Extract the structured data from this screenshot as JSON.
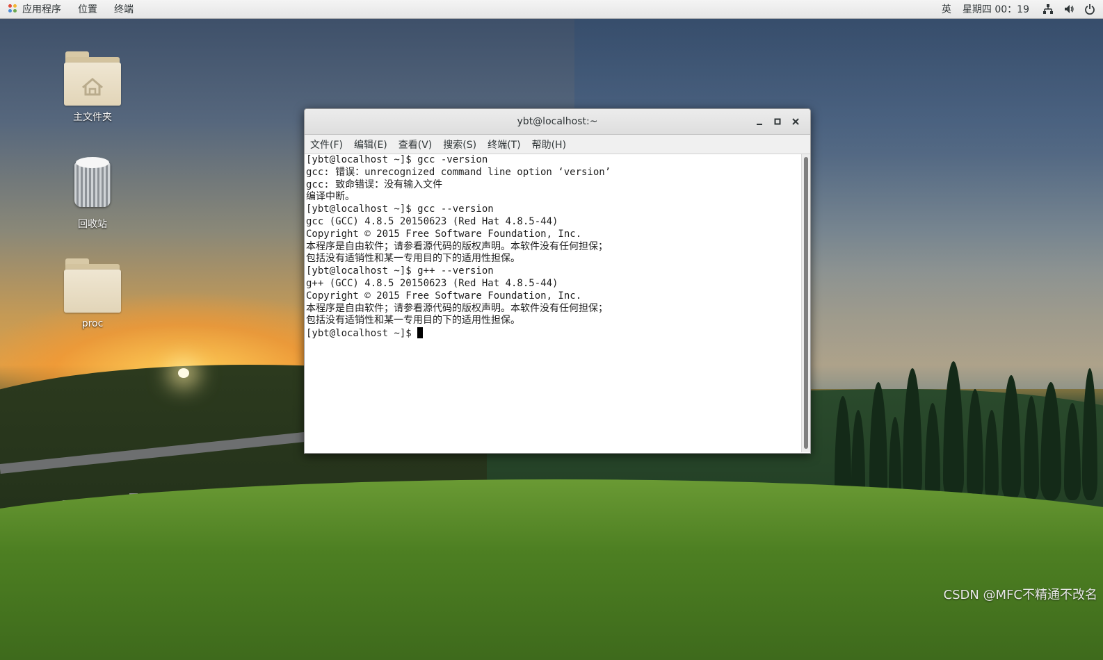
{
  "top_panel": {
    "applications": "应用程序",
    "places": "位置",
    "terminal": "终端",
    "input_method": "英",
    "clock": "星期四 00：19",
    "network_icon": "network-icon",
    "volume_icon": "volume-icon",
    "power_icon": "power-icon"
  },
  "desktop": {
    "icons": [
      {
        "label": "主文件夹",
        "icon": "home-folder-icon"
      },
      {
        "label": "回收站",
        "icon": "trash-icon"
      },
      {
        "label": "proc",
        "icon": "folder-icon"
      }
    ]
  },
  "terminal": {
    "title": "ybt@localhost:~",
    "menu": [
      "文件(F)",
      "编辑(E)",
      "查看(V)",
      "搜索(S)",
      "终端(T)",
      "帮助(H)"
    ],
    "lines": [
      "[ybt@localhost ~]$ gcc -version",
      "gcc: 错误：unrecognized command line option ‘version’",
      "gcc: 致命错误：没有输入文件",
      "编译中断。",
      "[ybt@localhost ~]$ gcc --version",
      "gcc (GCC) 4.8.5 20150623 (Red Hat 4.8.5-44)",
      "Copyright © 2015 Free Software Foundation, Inc.",
      "本程序是自由软件；请参看源代码的版权声明。本软件没有任何担保；",
      "包括没有适销性和某一专用目的下的适用性担保。",
      "[ybt@localhost ~]$ g++ --version",
      "g++ (GCC) 4.8.5 20150623 (Red Hat 4.8.5-44)",
      "Copyright © 2015 Free Software Foundation, Inc.",
      "本程序是自由软件；请参看源代码的版权声明。本软件没有任何担保；",
      "包括没有适销性和某一专用目的下的适用性担保。"
    ],
    "prompt": "[ybt@localhost ~]$ "
  },
  "watermark": "CSDN @MFC不精通不改名"
}
